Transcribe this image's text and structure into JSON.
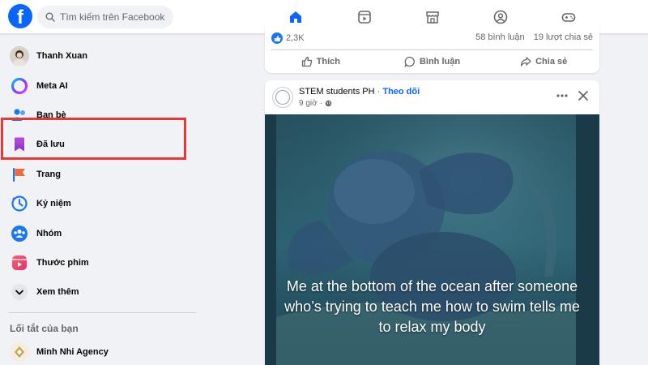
{
  "search": {
    "placeholder": "Tìm kiếm trên Facebook"
  },
  "nav": {
    "tabs": [
      {
        "name": "home",
        "active": true
      },
      {
        "name": "video",
        "active": false
      },
      {
        "name": "marketplace",
        "active": false
      },
      {
        "name": "groups",
        "active": false
      },
      {
        "name": "gaming",
        "active": false
      }
    ]
  },
  "sidebar": {
    "items": [
      {
        "label": "Thanh Xuan",
        "icon": "profile-avatar"
      },
      {
        "label": "Meta AI",
        "icon": "meta-ai-icon"
      },
      {
        "label": "Bạn bè",
        "icon": "friends-icon"
      },
      {
        "label": "Đã lưu",
        "icon": "saved-icon"
      },
      {
        "label": "Trang",
        "icon": "pages-flag-icon"
      },
      {
        "label": "Kỷ niệm",
        "icon": "memories-clock-icon"
      },
      {
        "label": "Nhóm",
        "icon": "groups-icon"
      },
      {
        "label": "Thước phim",
        "icon": "reels-icon"
      },
      {
        "label": "Xem thêm",
        "icon": "chevron-down-icon"
      }
    ],
    "shortcuts_title": "Lối tắt của bạn",
    "shortcuts": [
      {
        "label": "Minh Nhi Agency",
        "icon": "agency-avatar"
      }
    ]
  },
  "previous_post": {
    "reactions": "2,3K",
    "comments": "58 bình luận",
    "shares": "19 lượt chia sẻ",
    "actions": {
      "like": "Thích",
      "comment": "Bình luận",
      "share": "Chia sẻ"
    }
  },
  "post": {
    "author": "STEM students PH",
    "separator": "·",
    "follow": "Theo dõi",
    "time": "9 giờ",
    "caption": "Me at the bottom of the ocean after someone who’s trying to teach me how to swim tells me to relax my body"
  },
  "colors": {
    "brand": "#0866ff",
    "highlight": "#e53935",
    "background": "#f0f2f5"
  }
}
